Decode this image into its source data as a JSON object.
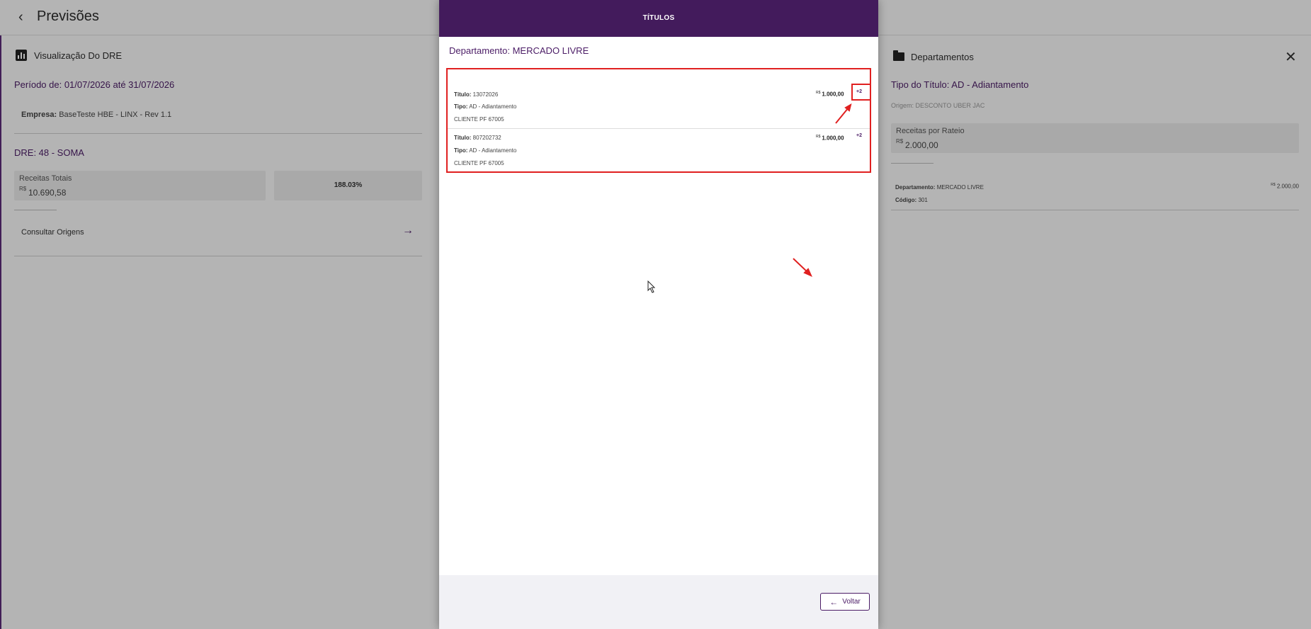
{
  "page": {
    "title": "Previsões"
  },
  "left": {
    "header": "Visualização Do DRE",
    "periodo": "Período de: 01/07/2026 até 31/07/2026",
    "empresa_label": "Empresa:",
    "empresa_value": "BaseTeste HBE - LINX - Rev 1.1",
    "dre": "DRE: 48 - SOMA",
    "receitas_label": "Receitas Totais",
    "receitas_currency": "R$",
    "receitas_value": "10.690,58",
    "percent": "188.03%",
    "consultar": "Consultar Origens"
  },
  "right": {
    "header": "Departamentos",
    "tipo_titulo": "Tipo do Título: AD - Adiantamento",
    "origem": "Origem: DESCONTO UBER JAC",
    "rateio_label": "Receitas por Rateio",
    "rateio_currency": "R$",
    "rateio_value": "2.000,00",
    "dep_label": "Departamento:",
    "dep_value": "MERCADO LIVRE",
    "dep_currency": "R$",
    "dep_amount": "2.000,00",
    "codigo_label": "Código:",
    "codigo_value": "301"
  },
  "modal": {
    "title": "TÍTULOS",
    "department": "Departamento: MERCADO LIVRE",
    "items": [
      {
        "titulo_label": "Título:",
        "titulo_value": "13072026",
        "tipo_label": "Tipo:",
        "tipo_value": "AD - Adiantamento",
        "cliente": "CLIENTE PF 67005",
        "currency": "R$",
        "amount": "1.000,00",
        "badge": "+2"
      },
      {
        "titulo_label": "Título:",
        "titulo_value": "807202732",
        "tipo_label": "Tipo:",
        "tipo_value": "AD - Adiantamento",
        "cliente": "CLIENTE PF 67005",
        "currency": "R$",
        "amount": "1.000,00",
        "badge": "+2"
      }
    ],
    "back_label": "Voltar"
  },
  "colors": {
    "brand": "#431b5c",
    "annotation": "#e02020"
  }
}
